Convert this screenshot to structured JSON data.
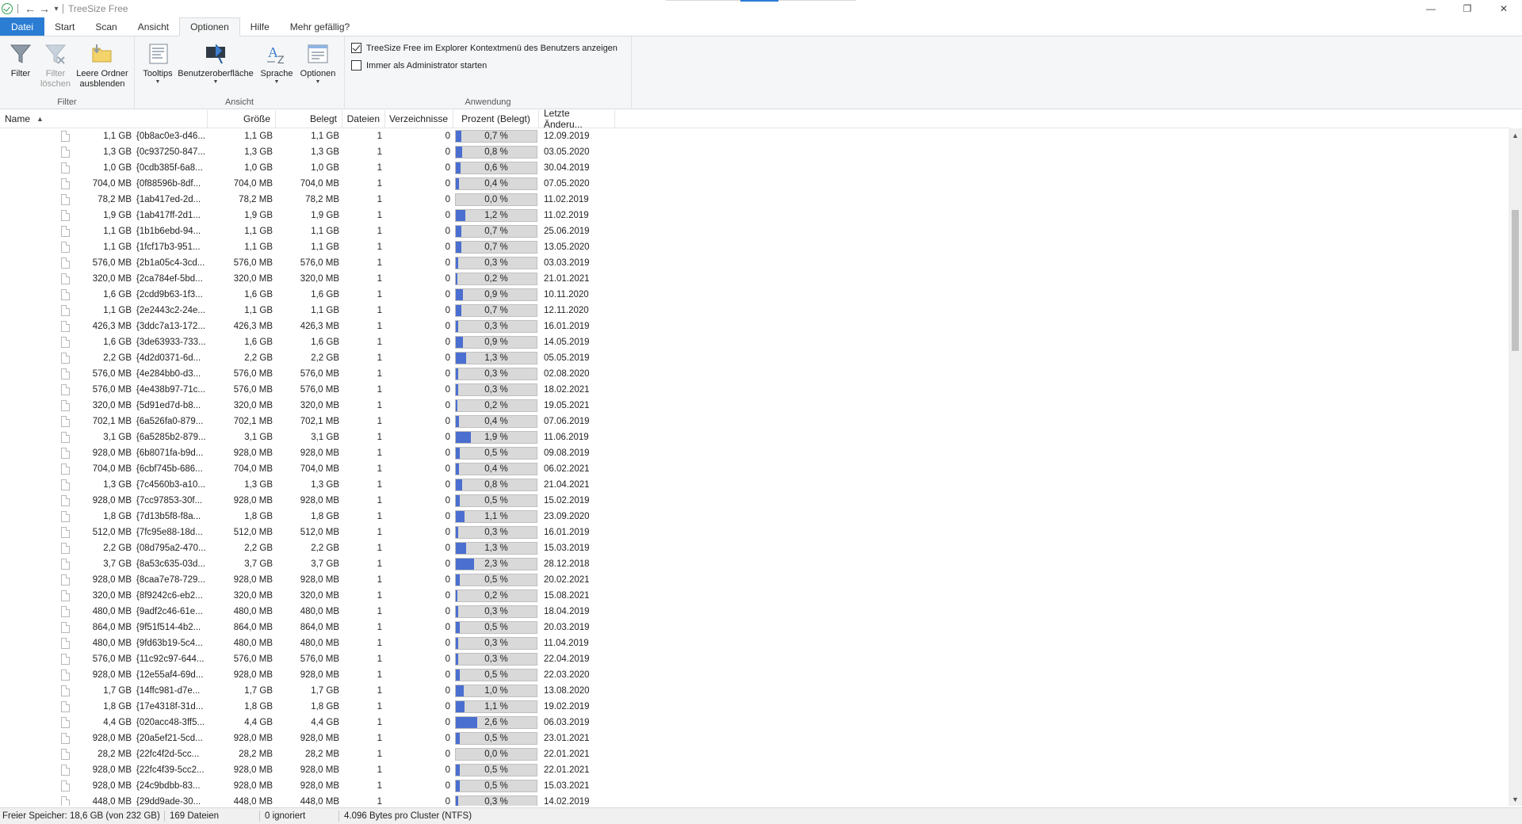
{
  "window": {
    "title": "TreeSize Free",
    "controls": {
      "minimize": "—",
      "restore": "❐",
      "close": "✕"
    }
  },
  "quick_access": {
    "back": "←",
    "forward": "→",
    "dropdown": "▾"
  },
  "ribbon_tabs": [
    {
      "label": "Datei"
    },
    {
      "label": "Start"
    },
    {
      "label": "Scan"
    },
    {
      "label": "Ansicht"
    },
    {
      "label": "Optionen"
    },
    {
      "label": "Hilfe"
    },
    {
      "label": "Mehr gefällig?"
    }
  ],
  "ribbon": {
    "filter_group": {
      "label": "Filter",
      "filter": "Filter",
      "filter_clear": "Filter löschen",
      "hide_empty": "Leere Ordner ausblenden"
    },
    "view_group": {
      "label": "Ansicht",
      "tooltips": "Tooltips",
      "ui": "Benutzeroberfläche",
      "language": "Sprache",
      "options": "Optionen"
    },
    "app_group": {
      "label": "Anwendung",
      "context_menu": "TreeSize Free im Explorer Kontextmenü des Benutzers anzeigen",
      "context_menu_checked": true,
      "admin_start": "Immer als Administrator starten",
      "admin_start_checked": false
    }
  },
  "columns": {
    "name": "Name",
    "size": "Größe",
    "allocated": "Belegt",
    "files": "Dateien",
    "folders": "Verzeichnisse",
    "percent": "Prozent (Belegt)",
    "modified": "Letzte Änderu..."
  },
  "rows": [
    {
      "name_size": "1,1 GB",
      "name": "{0b8ac0e3-d46...",
      "size": "1,1 GB",
      "allocated": "1,1 GB",
      "files": "1",
      "folders": "0",
      "percent": "0,7 %",
      "pct": 0.7,
      "modified": "12.09.2019"
    },
    {
      "name_size": "1,3 GB",
      "name": "{0c937250-847...",
      "size": "1,3 GB",
      "allocated": "1,3 GB",
      "files": "1",
      "folders": "0",
      "percent": "0,8 %",
      "pct": 0.8,
      "modified": "03.05.2020"
    },
    {
      "name_size": "1,0 GB",
      "name": "{0cdb385f-6a8...",
      "size": "1,0 GB",
      "allocated": "1,0 GB",
      "files": "1",
      "folders": "0",
      "percent": "0,6 %",
      "pct": 0.6,
      "modified": "30.04.2019"
    },
    {
      "name_size": "704,0 MB",
      "name": "{0f88596b-8df...",
      "size": "704,0 MB",
      "allocated": "704,0 MB",
      "files": "1",
      "folders": "0",
      "percent": "0,4 %",
      "pct": 0.4,
      "modified": "07.05.2020"
    },
    {
      "name_size": "78,2 MB",
      "name": "{1ab417ed-2d...",
      "size": "78,2 MB",
      "allocated": "78,2 MB",
      "files": "1",
      "folders": "0",
      "percent": "0,0 %",
      "pct": 0.0,
      "modified": "11.02.2019"
    },
    {
      "name_size": "1,9 GB",
      "name": "{1ab417ff-2d1...",
      "size": "1,9 GB",
      "allocated": "1,9 GB",
      "files": "1",
      "folders": "0",
      "percent": "1,2 %",
      "pct": 1.2,
      "modified": "11.02.2019"
    },
    {
      "name_size": "1,1 GB",
      "name": "{1b1b6ebd-94...",
      "size": "1,1 GB",
      "allocated": "1,1 GB",
      "files": "1",
      "folders": "0",
      "percent": "0,7 %",
      "pct": 0.7,
      "modified": "25.06.2019"
    },
    {
      "name_size": "1,1 GB",
      "name": "{1fcf17b3-951...",
      "size": "1,1 GB",
      "allocated": "1,1 GB",
      "files": "1",
      "folders": "0",
      "percent": "0,7 %",
      "pct": 0.7,
      "modified": "13.05.2020"
    },
    {
      "name_size": "576,0 MB",
      "name": "{2b1a05c4-3cd...",
      "size": "576,0 MB",
      "allocated": "576,0 MB",
      "files": "1",
      "folders": "0",
      "percent": "0,3 %",
      "pct": 0.3,
      "modified": "03.03.2019"
    },
    {
      "name_size": "320,0 MB",
      "name": "{2ca784ef-5bd...",
      "size": "320,0 MB",
      "allocated": "320,0 MB",
      "files": "1",
      "folders": "0",
      "percent": "0,2 %",
      "pct": 0.2,
      "modified": "21.01.2021"
    },
    {
      "name_size": "1,6 GB",
      "name": "{2cdd9b63-1f3...",
      "size": "1,6 GB",
      "allocated": "1,6 GB",
      "files": "1",
      "folders": "0",
      "percent": "0,9 %",
      "pct": 0.9,
      "modified": "10.11.2020"
    },
    {
      "name_size": "1,1 GB",
      "name": "{2e2443c2-24e...",
      "size": "1,1 GB",
      "allocated": "1,1 GB",
      "files": "1",
      "folders": "0",
      "percent": "0,7 %",
      "pct": 0.7,
      "modified": "12.11.2020"
    },
    {
      "name_size": "426,3 MB",
      "name": "{3ddc7a13-172...",
      "size": "426,3 MB",
      "allocated": "426,3 MB",
      "files": "1",
      "folders": "0",
      "percent": "0,3 %",
      "pct": 0.3,
      "modified": "16.01.2019"
    },
    {
      "name_size": "1,6 GB",
      "name": "{3de63933-733...",
      "size": "1,6 GB",
      "allocated": "1,6 GB",
      "files": "1",
      "folders": "0",
      "percent": "0,9 %",
      "pct": 0.9,
      "modified": "14.05.2019"
    },
    {
      "name_size": "2,2 GB",
      "name": "{4d2d0371-6d...",
      "size": "2,2 GB",
      "allocated": "2,2 GB",
      "files": "1",
      "folders": "0",
      "percent": "1,3 %",
      "pct": 1.3,
      "modified": "05.05.2019"
    },
    {
      "name_size": "576,0 MB",
      "name": "{4e284bb0-d3...",
      "size": "576,0 MB",
      "allocated": "576,0 MB",
      "files": "1",
      "folders": "0",
      "percent": "0,3 %",
      "pct": 0.3,
      "modified": "02.08.2020"
    },
    {
      "name_size": "576,0 MB",
      "name": "{4e438b97-71c...",
      "size": "576,0 MB",
      "allocated": "576,0 MB",
      "files": "1",
      "folders": "0",
      "percent": "0,3 %",
      "pct": 0.3,
      "modified": "18.02.2021"
    },
    {
      "name_size": "320,0 MB",
      "name": "{5d91ed7d-b8...",
      "size": "320,0 MB",
      "allocated": "320,0 MB",
      "files": "1",
      "folders": "0",
      "percent": "0,2 %",
      "pct": 0.2,
      "modified": "19.05.2021"
    },
    {
      "name_size": "702,1 MB",
      "name": "{6a526fa0-879...",
      "size": "702,1 MB",
      "allocated": "702,1 MB",
      "files": "1",
      "folders": "0",
      "percent": "0,4 %",
      "pct": 0.4,
      "modified": "07.06.2019"
    },
    {
      "name_size": "3,1 GB",
      "name": "{6a5285b2-879...",
      "size": "3,1 GB",
      "allocated": "3,1 GB",
      "files": "1",
      "folders": "0",
      "percent": "1,9 %",
      "pct": 1.9,
      "modified": "11.06.2019"
    },
    {
      "name_size": "928,0 MB",
      "name": "{6b8071fa-b9d...",
      "size": "928,0 MB",
      "allocated": "928,0 MB",
      "files": "1",
      "folders": "0",
      "percent": "0,5 %",
      "pct": 0.5,
      "modified": "09.08.2019"
    },
    {
      "name_size": "704,0 MB",
      "name": "{6cbf745b-686...",
      "size": "704,0 MB",
      "allocated": "704,0 MB",
      "files": "1",
      "folders": "0",
      "percent": "0,4 %",
      "pct": 0.4,
      "modified": "06.02.2021"
    },
    {
      "name_size": "1,3 GB",
      "name": "{7c4560b3-a10...",
      "size": "1,3 GB",
      "allocated": "1,3 GB",
      "files": "1",
      "folders": "0",
      "percent": "0,8 %",
      "pct": 0.8,
      "modified": "21.04.2021"
    },
    {
      "name_size": "928,0 MB",
      "name": "{7cc97853-30f...",
      "size": "928,0 MB",
      "allocated": "928,0 MB",
      "files": "1",
      "folders": "0",
      "percent": "0,5 %",
      "pct": 0.5,
      "modified": "15.02.2019"
    },
    {
      "name_size": "1,8 GB",
      "name": "{7d13b5f8-f8a...",
      "size": "1,8 GB",
      "allocated": "1,8 GB",
      "files": "1",
      "folders": "0",
      "percent": "1,1 %",
      "pct": 1.1,
      "modified": "23.09.2020"
    },
    {
      "name_size": "512,0 MB",
      "name": "{7fc95e88-18d...",
      "size": "512,0 MB",
      "allocated": "512,0 MB",
      "files": "1",
      "folders": "0",
      "percent": "0,3 %",
      "pct": 0.3,
      "modified": "16.01.2019"
    },
    {
      "name_size": "2,2 GB",
      "name": "{08d795a2-470...",
      "size": "2,2 GB",
      "allocated": "2,2 GB",
      "files": "1",
      "folders": "0",
      "percent": "1,3 %",
      "pct": 1.3,
      "modified": "15.03.2019"
    },
    {
      "name_size": "3,7 GB",
      "name": "{8a53c635-03d...",
      "size": "3,7 GB",
      "allocated": "3,7 GB",
      "files": "1",
      "folders": "0",
      "percent": "2,3 %",
      "pct": 2.3,
      "modified": "28.12.2018"
    },
    {
      "name_size": "928,0 MB",
      "name": "{8caa7e78-729...",
      "size": "928,0 MB",
      "allocated": "928,0 MB",
      "files": "1",
      "folders": "0",
      "percent": "0,5 %",
      "pct": 0.5,
      "modified": "20.02.2021"
    },
    {
      "name_size": "320,0 MB",
      "name": "{8f9242c6-eb2...",
      "size": "320,0 MB",
      "allocated": "320,0 MB",
      "files": "1",
      "folders": "0",
      "percent": "0,2 %",
      "pct": 0.2,
      "modified": "15.08.2021"
    },
    {
      "name_size": "480,0 MB",
      "name": "{9adf2c46-61e...",
      "size": "480,0 MB",
      "allocated": "480,0 MB",
      "files": "1",
      "folders": "0",
      "percent": "0,3 %",
      "pct": 0.3,
      "modified": "18.04.2019"
    },
    {
      "name_size": "864,0 MB",
      "name": "{9f51f514-4b2...",
      "size": "864,0 MB",
      "allocated": "864,0 MB",
      "files": "1",
      "folders": "0",
      "percent": "0,5 %",
      "pct": 0.5,
      "modified": "20.03.2019"
    },
    {
      "name_size": "480,0 MB",
      "name": "{9fd63b19-5c4...",
      "size": "480,0 MB",
      "allocated": "480,0 MB",
      "files": "1",
      "folders": "0",
      "percent": "0,3 %",
      "pct": 0.3,
      "modified": "11.04.2019"
    },
    {
      "name_size": "576,0 MB",
      "name": "{11c92c97-644...",
      "size": "576,0 MB",
      "allocated": "576,0 MB",
      "files": "1",
      "folders": "0",
      "percent": "0,3 %",
      "pct": 0.3,
      "modified": "22.04.2019"
    },
    {
      "name_size": "928,0 MB",
      "name": "{12e55af4-69d...",
      "size": "928,0 MB",
      "allocated": "928,0 MB",
      "files": "1",
      "folders": "0",
      "percent": "0,5 %",
      "pct": 0.5,
      "modified": "22.03.2020"
    },
    {
      "name_size": "1,7 GB",
      "name": "{14ffc981-d7e...",
      "size": "1,7 GB",
      "allocated": "1,7 GB",
      "files": "1",
      "folders": "0",
      "percent": "1,0 %",
      "pct": 1.0,
      "modified": "13.08.2020"
    },
    {
      "name_size": "1,8 GB",
      "name": "{17e4318f-31d...",
      "size": "1,8 GB",
      "allocated": "1,8 GB",
      "files": "1",
      "folders": "0",
      "percent": "1,1 %",
      "pct": 1.1,
      "modified": "19.02.2019"
    },
    {
      "name_size": "4,4 GB",
      "name": "{020acc48-3ff5...",
      "size": "4,4 GB",
      "allocated": "4,4 GB",
      "files": "1",
      "folders": "0",
      "percent": "2,6 %",
      "pct": 2.6,
      "modified": "06.03.2019"
    },
    {
      "name_size": "928,0 MB",
      "name": "{20a5ef21-5cd...",
      "size": "928,0 MB",
      "allocated": "928,0 MB",
      "files": "1",
      "folders": "0",
      "percent": "0,5 %",
      "pct": 0.5,
      "modified": "23.01.2021"
    },
    {
      "name_size": "28,2 MB",
      "name": "{22fc4f2d-5cc...",
      "size": "28,2 MB",
      "allocated": "28,2 MB",
      "files": "1",
      "folders": "0",
      "percent": "0,0 %",
      "pct": 0.0,
      "modified": "22.01.2021"
    },
    {
      "name_size": "928,0 MB",
      "name": "{22fc4f39-5cc2...",
      "size": "928,0 MB",
      "allocated": "928,0 MB",
      "files": "1",
      "folders": "0",
      "percent": "0,5 %",
      "pct": 0.5,
      "modified": "22.01.2021"
    },
    {
      "name_size": "928,0 MB",
      "name": "{24c9bdbb-83...",
      "size": "928,0 MB",
      "allocated": "928,0 MB",
      "files": "1",
      "folders": "0",
      "percent": "0,5 %",
      "pct": 0.5,
      "modified": "15.03.2021"
    },
    {
      "name_size": "448,0 MB",
      "name": "{29dd9ade-30...",
      "size": "448,0 MB",
      "allocated": "448,0 MB",
      "files": "1",
      "folders": "0",
      "percent": "0,3 %",
      "pct": 0.3,
      "modified": "14.02.2019"
    }
  ],
  "statusbar": {
    "free": "Freier Speicher: 18,6 GB  (von 232 GB)",
    "files": "169 Dateien",
    "ignored": "0 ignoriert",
    "cluster": "4.096 Bytes pro Cluster (NTFS)"
  },
  "colors": {
    "accent": "#2b7cd3",
    "bar_fill": "#4a6fd0",
    "bar_bg": "#d9d9d9"
  }
}
